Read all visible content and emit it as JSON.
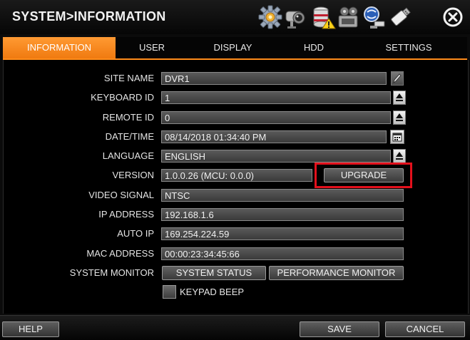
{
  "header": {
    "title": "SYSTEM>INFORMATION",
    "icons": [
      "gear-icon",
      "camera-icon",
      "database-warning-icon",
      "film-icon",
      "network-icon",
      "usb-drive-icon"
    ],
    "close_icon": "close-icon"
  },
  "tabs": [
    {
      "label": "INFORMATION",
      "active": true
    },
    {
      "label": "USER",
      "active": false
    },
    {
      "label": "DISPLAY",
      "active": false
    },
    {
      "label": "HDD",
      "active": false
    },
    {
      "label": "SETTINGS",
      "active": false
    }
  ],
  "fields": {
    "site_name": {
      "label": "SITE NAME",
      "value": "DVR1"
    },
    "keyboard_id": {
      "label": "KEYBOARD ID",
      "value": "1"
    },
    "remote_id": {
      "label": "REMOTE ID",
      "value": "0"
    },
    "date_time": {
      "label": "DATE/TIME",
      "value": "08/14/2018 01:34:40 PM"
    },
    "language": {
      "label": "LANGUAGE",
      "value": "ENGLISH"
    },
    "version": {
      "label": "VERSION",
      "value": "1.0.0.26 (MCU: 0.0.0)",
      "upgrade_label": "UPGRADE"
    },
    "video_signal": {
      "label": "VIDEO SIGNAL",
      "value": "NTSC"
    },
    "ip_address": {
      "label": "IP ADDRESS",
      "value": "192.168.1.6"
    },
    "auto_ip": {
      "label": "AUTO IP",
      "value": "169.254.224.59"
    },
    "mac_address": {
      "label": "MAC ADDRESS",
      "value": "00:00:23:34:45:66"
    },
    "system_monitor": {
      "label": "SYSTEM MONITOR",
      "status_label": "SYSTEM STATUS",
      "performance_label": "PERFORMANCE MONITOR"
    }
  },
  "keypad_beep": {
    "label": "KEYPAD BEEP",
    "checked": false
  },
  "footer": {
    "help_label": "HELP",
    "save_label": "SAVE",
    "cancel_label": "CANCEL"
  },
  "colors": {
    "accent": "#f58a1f",
    "highlight": "#e3101c"
  }
}
